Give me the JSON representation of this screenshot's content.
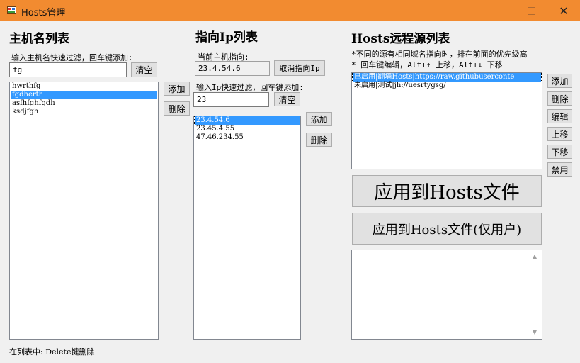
{
  "window": {
    "title": "Hosts管理",
    "minimize": "",
    "maximize": "",
    "close": "✕"
  },
  "hostnames": {
    "title": "主机名列表",
    "filter_label": "输入主机名快速过滤，回车键添加:",
    "filter_value": "fg",
    "clear_label": "清空",
    "add_label": "添加",
    "delete_label": "删除",
    "items": [
      "hwrthfg",
      "fgdherth",
      "asfhfghfgdh",
      "ksdjfgh"
    ],
    "selected_index": 1
  },
  "ips": {
    "title": "指向Ip列表",
    "current_label": "当前主机指向:",
    "current_value": "23.4.54.6",
    "cancel_label": "取消指向Ip",
    "filter_label": "输入Ip快速过滤，回车键添加:",
    "filter_value": "23",
    "clear_label": "清空",
    "add_label": "添加",
    "delete_label": "删除",
    "items": [
      "23.4.54.6",
      "23.45.4.55",
      "47.46.234.55"
    ],
    "selected_index": 0
  },
  "remote": {
    "title": "Hosts远程源列表",
    "note1": "*不同的源有相同域名指向时，排在前面的优先级高",
    "note2": "* 回车键编辑，Alt+↑ 上移，Alt+↓ 下移",
    "items": [
      "已启用|翻墙Hosts|https://raw.githubuserconte",
      "未启用|测试|jh://uesrtygsg/"
    ],
    "selected_index": 0,
    "buttons": {
      "add": "添加",
      "delete": "删除",
      "edit": "编辑",
      "up": "上移",
      "down": "下移",
      "disable": "禁用"
    },
    "apply_label": "应用到Hosts文件",
    "apply_user_label": "应用到Hosts文件(仅用户)",
    "log_text": ""
  },
  "status": {
    "text": "在列表中: Delete键删除"
  },
  "icons": {
    "scroll_up": "▲",
    "scroll_down": "▼"
  }
}
